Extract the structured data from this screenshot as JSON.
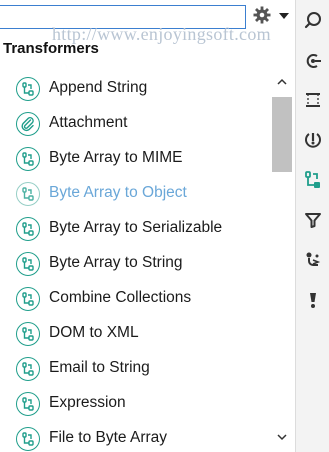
{
  "search": {
    "value": "",
    "placeholder": ""
  },
  "watermark": "http://www.enjoyingsoft.com",
  "section_title": "Transformers",
  "items": [
    {
      "label": "Append String",
      "icon": "transformer-icon"
    },
    {
      "label": "Attachment",
      "icon": "paperclip-icon"
    },
    {
      "label": "Byte Array to MIME",
      "icon": "transformer-icon"
    },
    {
      "label": "Byte Array to Object",
      "icon": "transformer-icon"
    },
    {
      "label": "Byte Array to Serializable",
      "icon": "transformer-icon"
    },
    {
      "label": "Byte Array to String",
      "icon": "transformer-icon"
    },
    {
      "label": "Combine Collections",
      "icon": "transformer-icon"
    },
    {
      "label": "DOM to XML",
      "icon": "transformer-icon"
    },
    {
      "label": "Email to String",
      "icon": "transformer-icon"
    },
    {
      "label": "Expression",
      "icon": "transformer-icon"
    },
    {
      "label": "File to Byte Array",
      "icon": "transformer-icon"
    }
  ],
  "colors": {
    "accent": "#1f9e8b",
    "input_border": "#3b7fd0",
    "watermark": "#b9c5d3"
  },
  "right_toolbar": [
    "search-icon",
    "connector-icon",
    "scope-icon",
    "component-icon",
    "transformer-icon",
    "filter-icon",
    "flow-control-icon",
    "error-handling-icon"
  ]
}
